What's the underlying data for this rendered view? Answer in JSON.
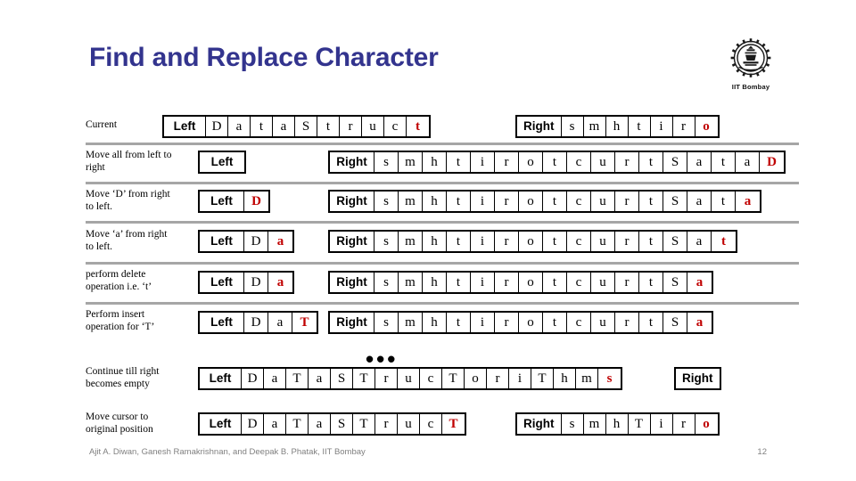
{
  "slide": {
    "title": "Find and Replace Character",
    "ellipsis": "•••",
    "accent_color": "#33348e",
    "highlight_color": "#c00000",
    "rule_color": "#a6a6a6"
  },
  "logo": {
    "icon": "iit-bombay-gear-emblem",
    "caption": "IIT Bombay"
  },
  "rows": [
    {
      "label": "Current",
      "left": {
        "head": "Left",
        "cells": [
          "D",
          "a",
          "t",
          "a",
          "S",
          "t",
          "r",
          "u",
          "c",
          "t"
        ],
        "red_index": 9
      },
      "right": {
        "head": "Right",
        "cells": [
          "s",
          "m",
          "h",
          "t",
          "i",
          "r",
          "o"
        ],
        "red_index": 6
      }
    },
    {
      "label": "Move all from left to right",
      "left": {
        "head": "Left",
        "cells": [],
        "red_index": -1
      },
      "right": {
        "head": "Right",
        "cells": [
          "s",
          "m",
          "h",
          "t",
          "i",
          "r",
          "o",
          "t",
          "c",
          "u",
          "r",
          "t",
          "S",
          "a",
          "t",
          "a",
          "D"
        ],
        "red_index": 16
      }
    },
    {
      "label": "Move ‘D’ from right to left.",
      "left": {
        "head": "Left",
        "cells": [
          "D"
        ],
        "red_index": 0
      },
      "right": {
        "head": "Right",
        "cells": [
          "s",
          "m",
          "h",
          "t",
          "i",
          "r",
          "o",
          "t",
          "c",
          "u",
          "r",
          "t",
          "S",
          "a",
          "t",
          "a"
        ],
        "red_index": 15
      }
    },
    {
      "label": "Move ‘a’ from right to left.",
      "left": {
        "head": "Left",
        "cells": [
          "D",
          "a"
        ],
        "red_index": 1
      },
      "right": {
        "head": "Right",
        "cells": [
          "s",
          "m",
          "h",
          "t",
          "i",
          "r",
          "o",
          "t",
          "c",
          "u",
          "r",
          "t",
          "S",
          "a",
          "t"
        ],
        "red_index": 14
      }
    },
    {
      "label": "perform delete operation i.e. ‘t’",
      "left": {
        "head": "Left",
        "cells": [
          "D",
          "a"
        ],
        "red_index": 1
      },
      "right": {
        "head": "Right",
        "cells": [
          "s",
          "m",
          "h",
          "t",
          "i",
          "r",
          "o",
          "t",
          "c",
          "u",
          "r",
          "t",
          "S",
          "a"
        ],
        "red_index": 13
      }
    },
    {
      "label": "Perform insert operation for ‘T’",
      "left": {
        "head": "Left",
        "cells": [
          "D",
          "a",
          "T"
        ],
        "red_index": 2
      },
      "right": {
        "head": "Right",
        "cells": [
          "s",
          "m",
          "h",
          "t",
          "i",
          "r",
          "o",
          "t",
          "c",
          "u",
          "r",
          "t",
          "S",
          "a"
        ],
        "red_index": 13
      }
    },
    {
      "label": "Continue till right becomes empty",
      "left": {
        "head": "Left",
        "cells": [
          "D",
          "a",
          "T",
          "a",
          "S",
          "T",
          "r",
          "u",
          "c",
          "T",
          "o",
          "r",
          "i",
          "T",
          "h",
          "m",
          "s"
        ],
        "red_index": 16
      },
      "right": {
        "head": "Right",
        "cells": [],
        "red_index": -1
      }
    },
    {
      "label": "Move cursor to original position",
      "left": {
        "head": "Left",
        "cells": [
          "D",
          "a",
          "T",
          "a",
          "S",
          "T",
          "r",
          "u",
          "c",
          "T"
        ],
        "red_index": 9
      },
      "right": {
        "head": "Right",
        "cells": [
          "s",
          "m",
          "h",
          "T",
          "i",
          "r",
          "o"
        ],
        "red_index": 6
      }
    }
  ],
  "footer": {
    "credit": "Ajit A. Diwan, Ganesh Ramakrishnan, and Deepak B. Phatak, IIT Bombay",
    "page_number": "12"
  }
}
